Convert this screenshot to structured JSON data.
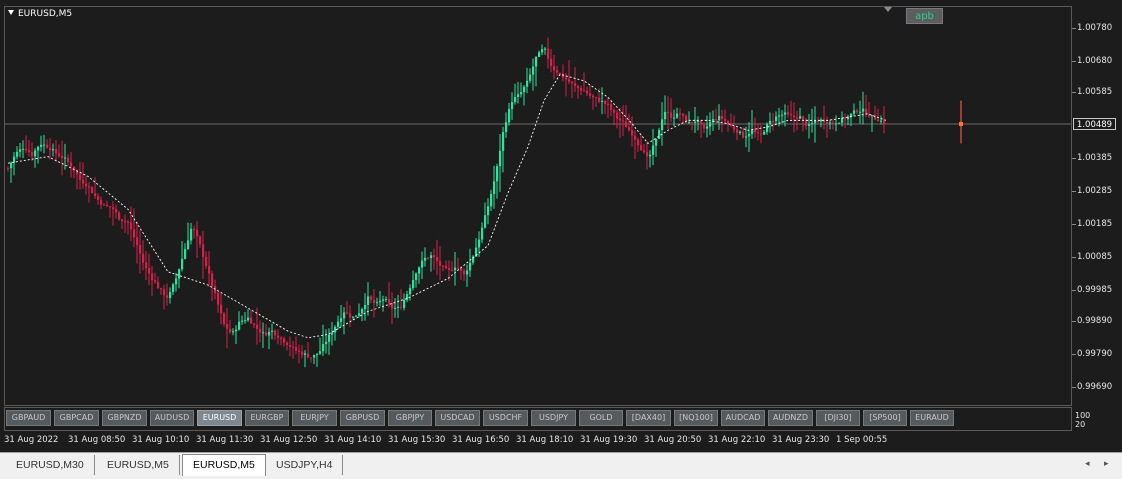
{
  "chart": {
    "symbol_title": "EURUSD,M5",
    "indicator_label": "apb",
    "current_price": "1.00489",
    "price_levels": [
      "1.00780",
      "1.00680",
      "1.00585",
      "1.00385",
      "1.00285",
      "1.00185",
      "1.00085",
      "0.99985",
      "0.99890",
      "0.99790",
      "0.99690"
    ],
    "subwindow_labels": [
      "100",
      "20"
    ],
    "colors": {
      "background": "#1c1c1c",
      "bull_candle": "#26e6a0",
      "bear_candle": "#d8204a",
      "moving_average": "#ffffff",
      "last_bar": "#ff7040",
      "bid_line": "#6a6a6a"
    }
  },
  "chart_data": {
    "type": "candlestick",
    "title": "EURUSD,M5",
    "ylim": [
      0.9966,
      1.0082
    ],
    "x_tick_labels": [
      "31 Aug 2022",
      "31 Aug 08:50",
      "31 Aug 10:10",
      "31 Aug 11:30",
      "31 Aug 12:50",
      "31 Aug 14:10",
      "31 Aug 15:30",
      "31 Aug 16:50",
      "31 Aug 18:10",
      "31 Aug 19:30",
      "31 Aug 20:50",
      "31 Aug 22:10",
      "31 Aug 23:30",
      "1 Sep 00:55"
    ],
    "close_path": [
      [
        0,
        1.00355
      ],
      [
        8,
        1.004
      ],
      [
        16,
        1.0042
      ],
      [
        24,
        1.00395
      ],
      [
        32,
        1.0043
      ],
      [
        40,
        1.0042
      ],
      [
        48,
        1.004
      ],
      [
        56,
        1.00385
      ],
      [
        64,
        1.0036
      ],
      [
        72,
        1.0032
      ],
      [
        80,
        1.003
      ],
      [
        88,
        1.00265
      ],
      [
        96,
        1.0024
      ],
      [
        104,
        1.00235
      ],
      [
        112,
        1.002
      ],
      [
        120,
        1.0019
      ],
      [
        128,
        1.0013
      ],
      [
        136,
        1.0006
      ],
      [
        144,
        1.0002
      ],
      [
        152,
        0.99985
      ],
      [
        160,
        0.9996
      ],
      [
        168,
        1.0002
      ],
      [
        176,
        1.001
      ],
      [
        184,
        1.0018
      ],
      [
        192,
        1.0012
      ],
      [
        200,
        1.0004
      ],
      [
        208,
        0.9996
      ],
      [
        216,
        0.9988
      ],
      [
        224,
        0.9985
      ],
      [
        232,
        0.9989
      ],
      [
        240,
        0.999
      ],
      [
        248,
        0.9987
      ],
      [
        256,
        0.9985
      ],
      [
        264,
        0.9986
      ],
      [
        272,
        0.9984
      ],
      [
        280,
        0.9982
      ],
      [
        288,
        0.998
      ],
      [
        296,
        0.9979
      ],
      [
        304,
        0.9978
      ],
      [
        312,
        0.998
      ],
      [
        320,
        0.9984
      ],
      [
        328,
        0.9988
      ],
      [
        336,
        0.9992
      ],
      [
        344,
        0.999
      ],
      [
        352,
        0.9992
      ],
      [
        360,
        0.9996
      ],
      [
        368,
        0.9994
      ],
      [
        376,
        0.9996
      ],
      [
        384,
        0.9993
      ],
      [
        392,
        0.9993
      ],
      [
        400,
        0.9998
      ],
      [
        408,
        1.0004
      ],
      [
        416,
        1.0008
      ],
      [
        424,
        1.0009
      ],
      [
        432,
        1.0006
      ],
      [
        440,
        1.0004
      ],
      [
        448,
        1.0006
      ],
      [
        456,
        1.0003
      ],
      [
        464,
        1.0008
      ],
      [
        472,
        1.0015
      ],
      [
        480,
        1.0024
      ],
      [
        488,
        1.0034
      ],
      [
        496,
        1.0048
      ],
      [
        504,
        1.0056
      ],
      [
        512,
        1.0058
      ],
      [
        520,
        1.0062
      ],
      [
        528,
        1.0069
      ],
      [
        536,
        1.0072
      ],
      [
        544,
        1.0066
      ],
      [
        552,
        1.0064
      ],
      [
        560,
        1.0062
      ],
      [
        568,
        1.006
      ],
      [
        576,
        1.0059
      ],
      [
        584,
        1.0057
      ],
      [
        592,
        1.0056
      ],
      [
        600,
        1.00545
      ],
      [
        608,
        1.0051
      ],
      [
        616,
        1.0049
      ],
      [
        624,
        1.0046
      ],
      [
        632,
        1.0042
      ],
      [
        640,
        1.0038
      ],
      [
        648,
        1.0044
      ],
      [
        656,
        1.0053
      ],
      [
        664,
        1.0051
      ],
      [
        672,
        1.0052
      ],
      [
        680,
        1.0049
      ],
      [
        688,
        1.005
      ],
      [
        696,
        1.0047
      ],
      [
        704,
        1.005
      ],
      [
        712,
        1.0051
      ],
      [
        720,
        1.0049
      ],
      [
        728,
        1.0047
      ],
      [
        736,
        1.0045
      ],
      [
        744,
        1.0047
      ],
      [
        752,
        1.0045
      ],
      [
        760,
        1.0049
      ],
      [
        768,
        1.0051
      ],
      [
        776,
        1.0052
      ],
      [
        784,
        1.0051
      ],
      [
        792,
        1.0051
      ],
      [
        800,
        1.0048
      ],
      [
        808,
        1.005
      ],
      [
        816,
        1.005
      ],
      [
        824,
        1.0049
      ],
      [
        832,
        1.005
      ],
      [
        840,
        1.0051
      ],
      [
        848,
        1.0053
      ],
      [
        856,
        1.0053
      ],
      [
        864,
        1.0051
      ],
      [
        872,
        1.005
      ],
      [
        878,
        1.00489
      ]
    ],
    "ma_path": [
      [
        0,
        1.0037
      ],
      [
        40,
        1.0039
      ],
      [
        80,
        1.0033
      ],
      [
        120,
        1.0023
      ],
      [
        160,
        1.0004
      ],
      [
        200,
        1.0
      ],
      [
        240,
        0.9993
      ],
      [
        280,
        0.9986
      ],
      [
        300,
        0.9984
      ],
      [
        320,
        0.9985
      ],
      [
        360,
        0.9992
      ],
      [
        400,
        0.9996
      ],
      [
        440,
        1.0002
      ],
      [
        480,
        1.0012
      ],
      [
        500,
        1.0028
      ],
      [
        520,
        1.0042
      ],
      [
        536,
        1.0056
      ],
      [
        552,
        1.0064
      ],
      [
        576,
        1.0062
      ],
      [
        600,
        1.0057
      ],
      [
        624,
        1.0049
      ],
      [
        640,
        1.0043
      ],
      [
        660,
        1.0047
      ],
      [
        680,
        1.005
      ],
      [
        700,
        1.005
      ],
      [
        720,
        1.0049
      ],
      [
        740,
        1.0047
      ],
      [
        760,
        1.0048
      ],
      [
        780,
        1.005
      ],
      [
        800,
        1.005
      ],
      [
        820,
        1.005
      ],
      [
        840,
        1.0051
      ],
      [
        860,
        1.0052
      ],
      [
        878,
        1.005
      ]
    ],
    "last_bar": {
      "x": 956,
      "high": 1.0056,
      "low": 1.0043,
      "close": 1.00489
    }
  },
  "symbol_bar": {
    "buttons": [
      "GBPAUD",
      "GBPCAD",
      "GBPNZD",
      "AUDUSD",
      "EURUSD",
      "EURGBP",
      "EURJPY",
      "GBPUSD",
      "GBPJPY",
      "USDCAD",
      "USDCHF",
      "USDJPY",
      "GOLD",
      "[DAX40]",
      "[NQ100]",
      "AUDCAD",
      "AUDNZD",
      "[DJI30]",
      "[SP500]",
      "EURAUD"
    ],
    "active": "EURUSD"
  },
  "tabs": {
    "items": [
      "EURUSD,M30",
      "EURUSD,M5",
      "EURUSD,M5",
      "USDJPY,H4"
    ],
    "active_index": 2,
    "scroll_left": "◂",
    "scroll_right": "▸"
  }
}
